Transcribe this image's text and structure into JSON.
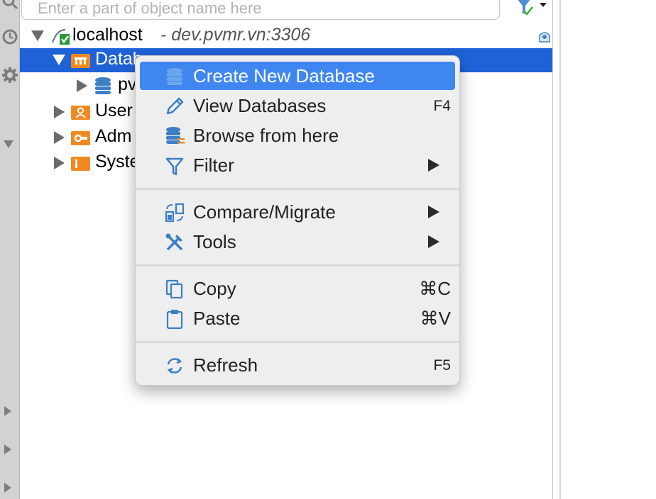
{
  "search": {
    "placeholder": "Enter a part of object name here"
  },
  "tree": {
    "host": {
      "name": "localhost",
      "detail": "- dev.pvmr.vn:3306"
    },
    "databases_label": "Datab",
    "database_item": "pv",
    "users_label": "User",
    "admin_label": "Adm",
    "system_label": "Syste"
  },
  "context_menu": {
    "items": [
      {
        "label": "Create New Database",
        "icon": "database-icon",
        "shortcut": ""
      },
      {
        "label": "View Databases",
        "icon": "pencil-icon",
        "shortcut": "F4"
      },
      {
        "label": "Browse from here",
        "icon": "browse-database-icon",
        "shortcut": ""
      },
      {
        "label": "Filter",
        "icon": "filter-icon",
        "shortcut": "",
        "submenu": true
      },
      {
        "label": "Compare/Migrate",
        "icon": "compare-migrate-icon",
        "shortcut": "",
        "submenu": true
      },
      {
        "label": "Tools",
        "icon": "tools-icon",
        "shortcut": "",
        "submenu": true
      },
      {
        "label": "Copy",
        "icon": "copy-icon",
        "shortcut": "⌘C"
      },
      {
        "label": "Paste",
        "icon": "paste-icon",
        "shortcut": "⌘V"
      },
      {
        "label": "Refresh",
        "icon": "refresh-icon",
        "shortcut": "F5"
      }
    ]
  },
  "colors": {
    "selection": "#1f62d8",
    "menu_highlight": "#3f86f0",
    "icon_blue": "#3d7fc4",
    "folder_orange": "#ef8a22"
  }
}
